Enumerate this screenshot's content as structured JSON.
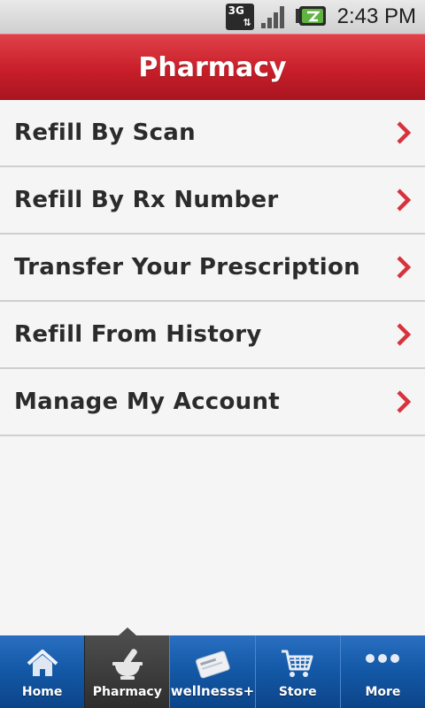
{
  "status_bar": {
    "network_label": "3G",
    "time": "2:43 PM"
  },
  "header": {
    "title": "Pharmacy"
  },
  "menu": {
    "items": [
      {
        "label": "Refill By Scan"
      },
      {
        "label": "Refill By Rx Number"
      },
      {
        "label": "Transfer Your Prescription"
      },
      {
        "label": "Refill From History"
      },
      {
        "label": "Manage My Account"
      }
    ]
  },
  "tabs": [
    {
      "label": "Home",
      "icon": "house-icon"
    },
    {
      "label": "Pharmacy",
      "icon": "mortar-pestle-icon",
      "active": true
    },
    {
      "label": "wellnesss+",
      "icon": "wellness-card-icon"
    },
    {
      "label": "Store",
      "icon": "shopping-cart-icon"
    },
    {
      "label": "More",
      "icon": "more-dots-icon"
    }
  ],
  "colors": {
    "header_red": "#c81e29",
    "chevron_red": "#d8323c",
    "tabbar_blue": "#145aa8"
  }
}
